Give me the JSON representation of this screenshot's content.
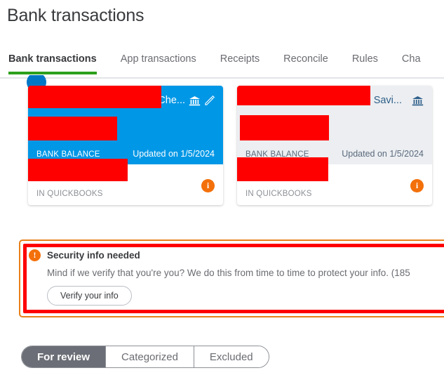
{
  "page": {
    "title": "Bank transactions"
  },
  "tabs": [
    {
      "label": "Bank transactions",
      "active": true
    },
    {
      "label": "App transactions",
      "active": false
    },
    {
      "label": "Receipts",
      "active": false
    },
    {
      "label": "Reconcile",
      "active": false
    },
    {
      "label": "Rules",
      "active": false
    },
    {
      "label": "Cha",
      "active": false
    }
  ],
  "accent": {
    "tab_underline": "#2ca01c",
    "selected_card": "#0097e6",
    "unselected_card": "#eceef1",
    "info_orange": "#f3700b",
    "alert_border": "#e8801a",
    "annotation_red": "#ff0000",
    "segment_active": "#6b6e76"
  },
  "cards": [
    {
      "name_suffix": "- Che...",
      "selected": true,
      "bank_icon": "bank-icon",
      "edit_icon": "pencil-edit-icon",
      "balance_label": "BANK BALANCE",
      "updated": "Updated on 1/5/2024",
      "quickbooks_label": "IN QUICKBOOKS",
      "info_icon": "info-icon",
      "info_glyph": "i"
    },
    {
      "name_suffix": "- Savi...",
      "selected": false,
      "bank_icon": "bank-icon",
      "edit_icon": null,
      "balance_label": "BANK BALANCE",
      "updated": "Updated on 1/5/2024",
      "quickbooks_label": "IN QUICKBOOKS",
      "info_icon": "info-icon",
      "info_glyph": "i"
    }
  ],
  "alert": {
    "icon": "alert-exclamation-icon",
    "icon_glyph": "!",
    "title": "Security info needed",
    "body": "Mind if we verify that you're you? We do this from time to time to protect your info. (185",
    "button_label": "Verify your info"
  },
  "segmented": [
    {
      "label": "For review",
      "active": true
    },
    {
      "label": "Categorized",
      "active": false
    },
    {
      "label": "Excluded",
      "active": false
    }
  ]
}
